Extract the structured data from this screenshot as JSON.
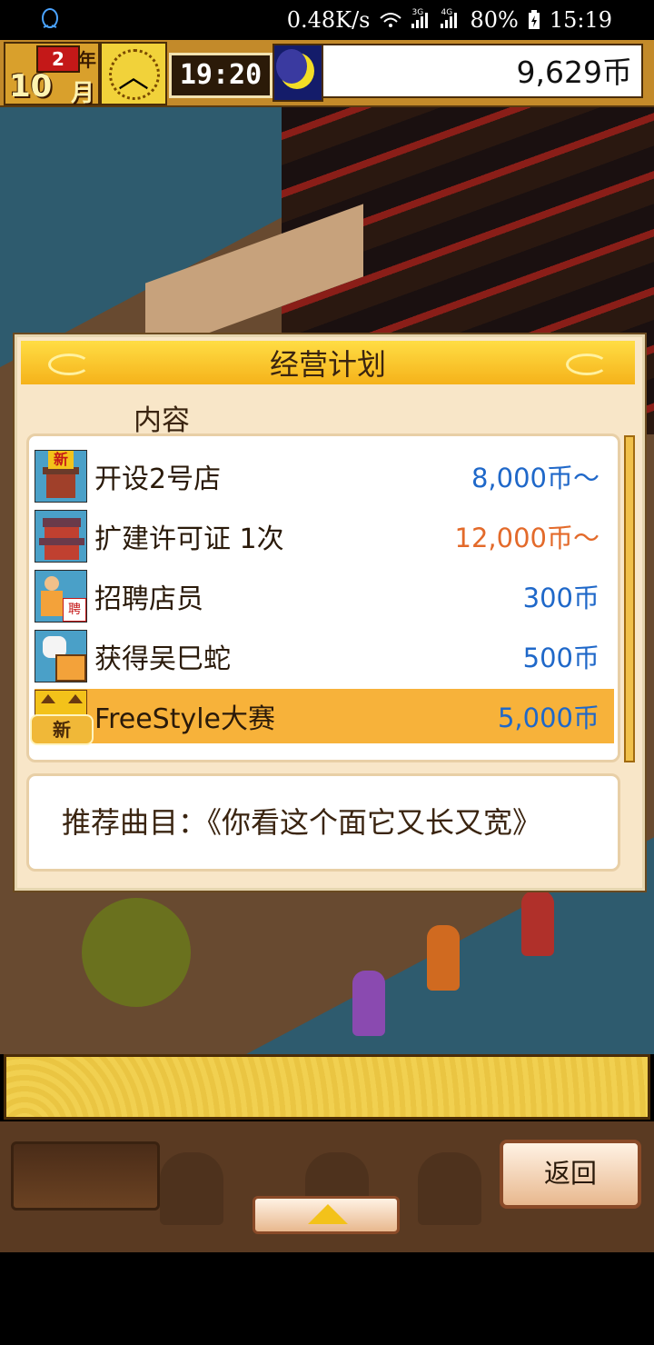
{
  "status_bar": {
    "net_speed": "0.48K/s",
    "net3g": "3G",
    "net4g": "4G",
    "battery": "80%",
    "time": "15:19"
  },
  "top_bar": {
    "year_num": "2",
    "year_label": "年",
    "month_num": "10",
    "month_label": "月",
    "game_time": "19:20",
    "money": "9,629币"
  },
  "dialog": {
    "title": "经营计划",
    "header": "内容",
    "items": [
      {
        "label": "开设2号店",
        "price": "8,000币～",
        "price_color": "#1f68c9",
        "icon": "new-shop-icon",
        "badge": "新"
      },
      {
        "label": "扩建许可证 1次",
        "price": "12,000币～",
        "price_color": "#e36a2a",
        "icon": "expansion-building-icon"
      },
      {
        "label": "招聘店员",
        "price": "300币",
        "price_color": "#1f68c9",
        "icon": "hire-staff-icon",
        "badge": "聘"
      },
      {
        "label": "获得吴巳蛇",
        "price": "500币",
        "price_color": "#1f68c9",
        "icon": "get-character-icon"
      },
      {
        "label": "FreeStyle大赛",
        "price": "5,000币",
        "price_color": "#1f68c9",
        "icon": "contest-icon",
        "new_badge": "新"
      }
    ],
    "recommend": "推荐曲目：《你看这个面它又长又宽》"
  },
  "bottom": {
    "back_label": "返回"
  },
  "colors": {
    "title_gold": "#f5b21a",
    "selected_row": "#f7b23a",
    "price_blue": "#1f68c9",
    "price_orange": "#e36a2a"
  }
}
